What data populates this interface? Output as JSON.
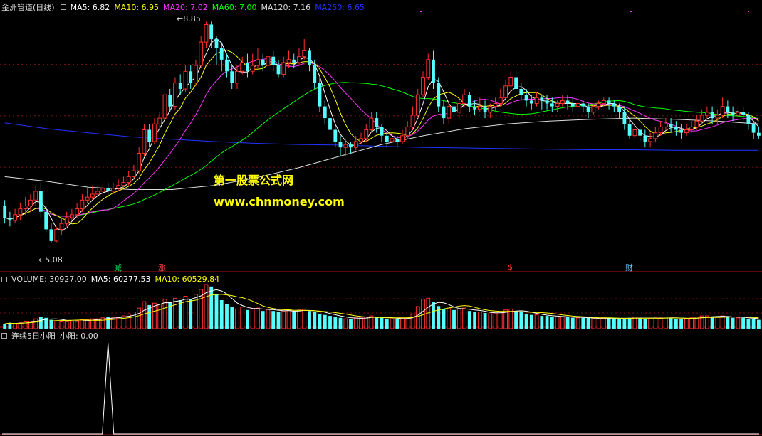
{
  "header": {
    "title": "金洲管道(日线)",
    "ma_values": [
      {
        "label": "MA5: 6.82",
        "color": "#ffffff"
      },
      {
        "label": "MA10: 6.95",
        "color": "#ffff00"
      },
      {
        "label": "MA20: 7.02",
        "color": "#ff33ff"
      },
      {
        "label": "MA60: 7.00",
        "color": "#00ff00"
      },
      {
        "label": "MA120: 7.16",
        "color": "#dddddd"
      },
      {
        "label": "MA250: 6.65",
        "color": "#2233ff"
      }
    ]
  },
  "volume_header": {
    "title": "VOLUME: 30927.00",
    "ma5": "MA5: 60277.53",
    "ma10": "MA10: 60529.84"
  },
  "indicator_header": {
    "title": "连续5日小阳",
    "value": "小阳: 0.00"
  },
  "annotations": {
    "high": "8.85",
    "low": "5.08",
    "marker_1": "减",
    "marker_2": "涨",
    "marker_3": "$",
    "marker_4": "财"
  },
  "watermark": {
    "line1": "第一股票公式网",
    "line2": "www.chnmoney.com"
  },
  "colors": {
    "up": "#ff3030",
    "down": "#54ffff",
    "ma5": "#ffffff",
    "ma10": "#ffff00",
    "ma20": "#ff33ff",
    "ma60": "#00ff00",
    "ma120": "#dddddd",
    "ma250": "#2233ff",
    "divider": "#b01010",
    "watermark": "#ffff00"
  },
  "chart_data": {
    "type": "candlestick",
    "price_axis_range": [
      4.6,
      9.0
    ],
    "candles": [
      [
        5.7,
        5.5,
        5.8,
        5.4
      ],
      [
        5.5,
        5.45,
        5.6,
        5.35
      ],
      [
        5.45,
        5.55,
        5.65,
        5.4
      ],
      [
        5.55,
        5.65,
        5.75,
        5.45
      ],
      [
        5.65,
        5.7,
        5.85,
        5.55
      ],
      [
        5.7,
        5.8,
        5.9,
        5.6
      ],
      [
        5.8,
        5.95,
        6.05,
        5.7
      ],
      [
        5.95,
        5.6,
        6.1,
        5.5
      ],
      [
        5.6,
        5.3,
        5.7,
        5.25
      ],
      [
        5.3,
        5.1,
        5.4,
        5.08
      ],
      [
        5.1,
        5.3,
        5.35,
        5.08
      ],
      [
        5.3,
        5.4,
        5.5,
        5.2
      ],
      [
        5.4,
        5.5,
        5.6,
        5.35
      ],
      [
        5.5,
        5.55,
        5.65,
        5.45
      ],
      [
        5.55,
        5.65,
        5.75,
        5.5
      ],
      [
        5.65,
        5.8,
        5.9,
        5.6
      ],
      [
        5.8,
        5.85,
        6.0,
        5.75
      ],
      [
        5.85,
        5.9,
        6.05,
        5.8
      ],
      [
        5.9,
        5.95,
        6.05,
        5.85
      ],
      [
        5.95,
        6.0,
        6.1,
        5.9
      ],
      [
        6.0,
        5.95,
        6.1,
        5.85
      ],
      [
        5.95,
        6.0,
        6.1,
        5.9
      ],
      [
        6.0,
        6.05,
        6.15,
        5.95
      ],
      [
        6.05,
        6.1,
        6.2,
        6.0
      ],
      [
        6.1,
        6.2,
        6.3,
        6.05
      ],
      [
        6.2,
        6.3,
        6.4,
        6.15
      ],
      [
        6.3,
        6.6,
        6.7,
        6.25
      ],
      [
        6.6,
        7.0,
        7.1,
        6.55
      ],
      [
        7.0,
        6.8,
        7.1,
        6.7
      ],
      [
        6.8,
        7.1,
        7.2,
        6.75
      ],
      [
        7.1,
        7.2,
        7.3,
        7.0
      ],
      [
        7.2,
        7.6,
        7.7,
        7.15
      ],
      [
        7.6,
        7.4,
        7.7,
        7.3
      ],
      [
        7.4,
        7.8,
        7.9,
        7.35
      ],
      [
        7.8,
        7.7,
        7.95,
        7.6
      ],
      [
        7.7,
        8.0,
        8.1,
        7.65
      ],
      [
        8.0,
        7.8,
        8.1,
        7.7
      ],
      [
        7.8,
        8.1,
        8.2,
        7.75
      ],
      [
        8.1,
        8.5,
        8.6,
        8.05
      ],
      [
        8.5,
        8.8,
        8.85,
        8.4
      ],
      [
        8.8,
        8.55,
        8.85,
        8.4
      ],
      [
        8.55,
        8.4,
        8.6,
        8.1
      ],
      [
        8.4,
        8.2,
        8.5,
        8.0
      ],
      [
        8.2,
        8.0,
        8.3,
        7.9
      ],
      [
        8.0,
        7.8,
        8.1,
        7.7
      ],
      [
        7.8,
        8.0,
        8.1,
        7.7
      ],
      [
        8.0,
        8.15,
        8.25,
        7.95
      ],
      [
        8.15,
        8.0,
        8.3,
        7.9
      ],
      [
        8.0,
        8.1,
        8.3,
        7.95
      ],
      [
        8.1,
        8.2,
        8.4,
        8.05
      ],
      [
        8.2,
        8.1,
        8.3,
        8.0
      ],
      [
        8.1,
        8.25,
        8.4,
        8.05
      ],
      [
        8.25,
        8.1,
        8.35,
        8.0
      ],
      [
        8.1,
        7.95,
        8.2,
        7.9
      ],
      [
        7.95,
        8.15,
        8.25,
        7.9
      ],
      [
        8.15,
        8.2,
        8.35,
        8.05
      ],
      [
        8.2,
        8.15,
        8.3,
        8.05
      ],
      [
        8.15,
        8.25,
        8.4,
        8.1
      ],
      [
        8.25,
        8.35,
        8.55,
        8.2
      ],
      [
        8.35,
        8.1,
        8.4,
        8.0
      ],
      [
        8.1,
        7.8,
        8.2,
        7.7
      ],
      [
        7.8,
        7.4,
        7.9,
        7.3
      ],
      [
        7.4,
        7.2,
        7.5,
        7.1
      ],
      [
        7.2,
        7.0,
        7.3,
        6.9
      ],
      [
        7.0,
        6.8,
        7.1,
        6.7
      ],
      [
        6.8,
        6.7,
        6.9,
        6.55
      ],
      [
        6.7,
        6.75,
        6.85,
        6.55
      ],
      [
        6.75,
        6.7,
        6.8,
        6.6
      ],
      [
        6.7,
        6.8,
        6.9,
        6.65
      ],
      [
        6.8,
        6.85,
        6.95,
        6.75
      ],
      [
        6.85,
        7.0,
        7.1,
        6.8
      ],
      [
        7.0,
        7.2,
        7.3,
        6.95
      ],
      [
        7.2,
        7.05,
        7.3,
        6.95
      ],
      [
        7.05,
        6.9,
        7.1,
        6.8
      ],
      [
        6.9,
        6.8,
        6.95,
        6.7
      ],
      [
        6.8,
        6.85,
        6.95,
        6.7
      ],
      [
        6.85,
        6.8,
        6.9,
        6.7
      ],
      [
        6.8,
        6.9,
        7.0,
        6.75
      ],
      [
        6.9,
        7.05,
        7.15,
        6.85
      ],
      [
        7.05,
        7.25,
        7.4,
        7.0
      ],
      [
        7.25,
        7.6,
        7.7,
        7.2
      ],
      [
        7.6,
        7.9,
        8.0,
        7.55
      ],
      [
        7.9,
        8.2,
        8.3,
        7.85
      ],
      [
        8.2,
        7.8,
        8.35,
        7.7
      ],
      [
        7.8,
        7.4,
        7.9,
        7.3
      ],
      [
        7.4,
        7.2,
        7.5,
        7.1
      ],
      [
        7.2,
        7.4,
        7.5,
        7.1
      ],
      [
        7.4,
        7.3,
        7.6,
        7.2
      ],
      [
        7.3,
        7.45,
        7.55,
        7.2
      ],
      [
        7.45,
        7.6,
        7.7,
        7.4
      ],
      [
        7.6,
        7.4,
        7.65,
        7.3
      ],
      [
        7.4,
        7.35,
        7.5,
        7.25
      ],
      [
        7.35,
        7.4,
        7.55,
        7.3
      ],
      [
        7.4,
        7.3,
        7.5,
        7.2
      ],
      [
        7.3,
        7.4,
        7.45,
        7.2
      ],
      [
        7.4,
        7.45,
        7.55,
        7.3
      ],
      [
        7.45,
        7.55,
        7.7,
        7.4
      ],
      [
        7.55,
        7.75,
        7.85,
        7.5
      ],
      [
        7.75,
        7.9,
        8.0,
        7.65
      ],
      [
        7.9,
        7.7,
        8.0,
        7.6
      ],
      [
        7.7,
        7.6,
        7.8,
        7.5
      ],
      [
        7.6,
        7.5,
        7.7,
        7.4
      ],
      [
        7.5,
        7.45,
        7.6,
        7.35
      ],
      [
        7.45,
        7.55,
        7.65,
        7.4
      ],
      [
        7.55,
        7.5,
        7.6,
        7.35
      ],
      [
        7.5,
        7.45,
        7.6,
        7.35
      ],
      [
        7.45,
        7.4,
        7.55,
        7.3
      ],
      [
        7.4,
        7.45,
        7.5,
        7.3
      ],
      [
        7.45,
        7.5,
        7.6,
        7.4
      ],
      [
        7.5,
        7.45,
        7.6,
        7.35
      ],
      [
        7.45,
        7.4,
        7.55,
        7.3
      ],
      [
        7.4,
        7.45,
        7.5,
        7.35
      ],
      [
        7.45,
        7.4,
        7.5,
        7.3
      ],
      [
        7.4,
        7.3,
        7.45,
        7.2
      ],
      [
        7.3,
        7.4,
        7.45,
        7.25
      ],
      [
        7.4,
        7.45,
        7.5,
        7.35
      ],
      [
        7.45,
        7.5,
        7.55,
        7.4
      ],
      [
        7.5,
        7.45,
        7.55,
        7.35
      ],
      [
        7.45,
        7.4,
        7.5,
        7.3
      ],
      [
        7.4,
        7.3,
        7.45,
        7.2
      ],
      [
        7.3,
        7.1,
        7.4,
        7.0
      ],
      [
        7.1,
        6.9,
        7.2,
        6.85
      ],
      [
        6.9,
        7.0,
        7.1,
        6.85
      ],
      [
        7.0,
        6.9,
        7.05,
        6.8
      ],
      [
        6.9,
        6.8,
        7.0,
        6.7
      ],
      [
        6.8,
        6.85,
        6.95,
        6.7
      ],
      [
        6.85,
        6.95,
        7.05,
        6.8
      ],
      [
        6.95,
        7.05,
        7.15,
        6.9
      ],
      [
        7.05,
        7.1,
        7.2,
        7.0
      ],
      [
        7.1,
        7.05,
        7.2,
        6.95
      ],
      [
        7.05,
        7.0,
        7.15,
        6.9
      ],
      [
        7.0,
        6.95,
        7.1,
        6.85
      ],
      [
        6.95,
        7.0,
        7.1,
        6.9
      ],
      [
        7.0,
        7.05,
        7.15,
        6.95
      ],
      [
        7.05,
        7.15,
        7.25,
        7.0
      ],
      [
        7.15,
        7.25,
        7.35,
        7.1
      ],
      [
        7.25,
        7.3,
        7.4,
        7.2
      ],
      [
        7.3,
        7.2,
        7.4,
        7.1
      ],
      [
        7.2,
        7.25,
        7.35,
        7.1
      ],
      [
        7.25,
        7.4,
        7.55,
        7.2
      ],
      [
        7.4,
        7.3,
        7.5,
        7.2
      ],
      [
        7.3,
        7.25,
        7.4,
        7.15
      ],
      [
        7.25,
        7.3,
        7.4,
        7.2
      ],
      [
        7.3,
        7.25,
        7.4,
        7.15
      ],
      [
        7.25,
        7.1,
        7.3,
        7.0
      ],
      [
        7.1,
        6.95,
        7.15,
        6.85
      ],
      [
        6.95,
        6.9,
        7.05,
        6.85
      ]
    ],
    "volumes": [
      10,
      12,
      10,
      12,
      14,
      15,
      20,
      24,
      22,
      18,
      16,
      14,
      14,
      15,
      16,
      18,
      18,
      20,
      20,
      22,
      24,
      22,
      24,
      26,
      30,
      34,
      42,
      55,
      48,
      52,
      50,
      60,
      54,
      62,
      58,
      66,
      60,
      70,
      80,
      90,
      86,
      70,
      58,
      50,
      44,
      40,
      44,
      38,
      40,
      42,
      36,
      40,
      36,
      34,
      36,
      38,
      34,
      38,
      40,
      36,
      34,
      30,
      28,
      26,
      24,
      22,
      20,
      20,
      22,
      22,
      24,
      26,
      24,
      22,
      20,
      20,
      20,
      20,
      22,
      30,
      45,
      60,
      62,
      55,
      46,
      40,
      42,
      38,
      40,
      42,
      36,
      34,
      34,
      32,
      30,
      32,
      34,
      38,
      40,
      36,
      34,
      30,
      28,
      28,
      26,
      26,
      24,
      24,
      24,
      24,
      22,
      22,
      22,
      22,
      20,
      20,
      22,
      22,
      22,
      20,
      20,
      22,
      24,
      22,
      20,
      20,
      22,
      22,
      24,
      22,
      20,
      20,
      20,
      22,
      24,
      26,
      26,
      24,
      24,
      26,
      24,
      22,
      22,
      22,
      20,
      20,
      18
    ],
    "ma_lines": {
      "ma120": [
        [
          0,
          6.2
        ],
        [
          15,
          6.12
        ],
        [
          30,
          6.02
        ],
        [
          45,
          5.98
        ],
        [
          60,
          5.98
        ],
        [
          75,
          6.05
        ],
        [
          90,
          6.18
        ],
        [
          105,
          6.35
        ],
        [
          120,
          6.55
        ],
        [
          135,
          6.75
        ],
        [
          150,
          6.9
        ],
        [
          165,
          7.02
        ],
        [
          180,
          7.1
        ],
        [
          195,
          7.15
        ],
        [
          210,
          7.18
        ],
        [
          225,
          7.2
        ],
        [
          240,
          7.18
        ],
        [
          255,
          7.15
        ],
        [
          270,
          7.1
        ]
      ],
      "ma250": [
        [
          0,
          7.12
        ],
        [
          15,
          7.02
        ],
        [
          30,
          6.95
        ],
        [
          45,
          6.88
        ],
        [
          60,
          6.84
        ],
        [
          75,
          6.8
        ],
        [
          90,
          6.77
        ],
        [
          105,
          6.75
        ],
        [
          120,
          6.74
        ],
        [
          135,
          6.72
        ],
        [
          150,
          6.7
        ],
        [
          165,
          6.69
        ],
        [
          180,
          6.68
        ],
        [
          195,
          6.67
        ],
        [
          210,
          6.66
        ],
        [
          225,
          6.66
        ],
        [
          240,
          6.65
        ],
        [
          255,
          6.65
        ],
        [
          270,
          6.65
        ]
      ]
    },
    "indicator": {
      "spike_index": 20,
      "values": [
        0,
        1,
        0
      ]
    }
  }
}
